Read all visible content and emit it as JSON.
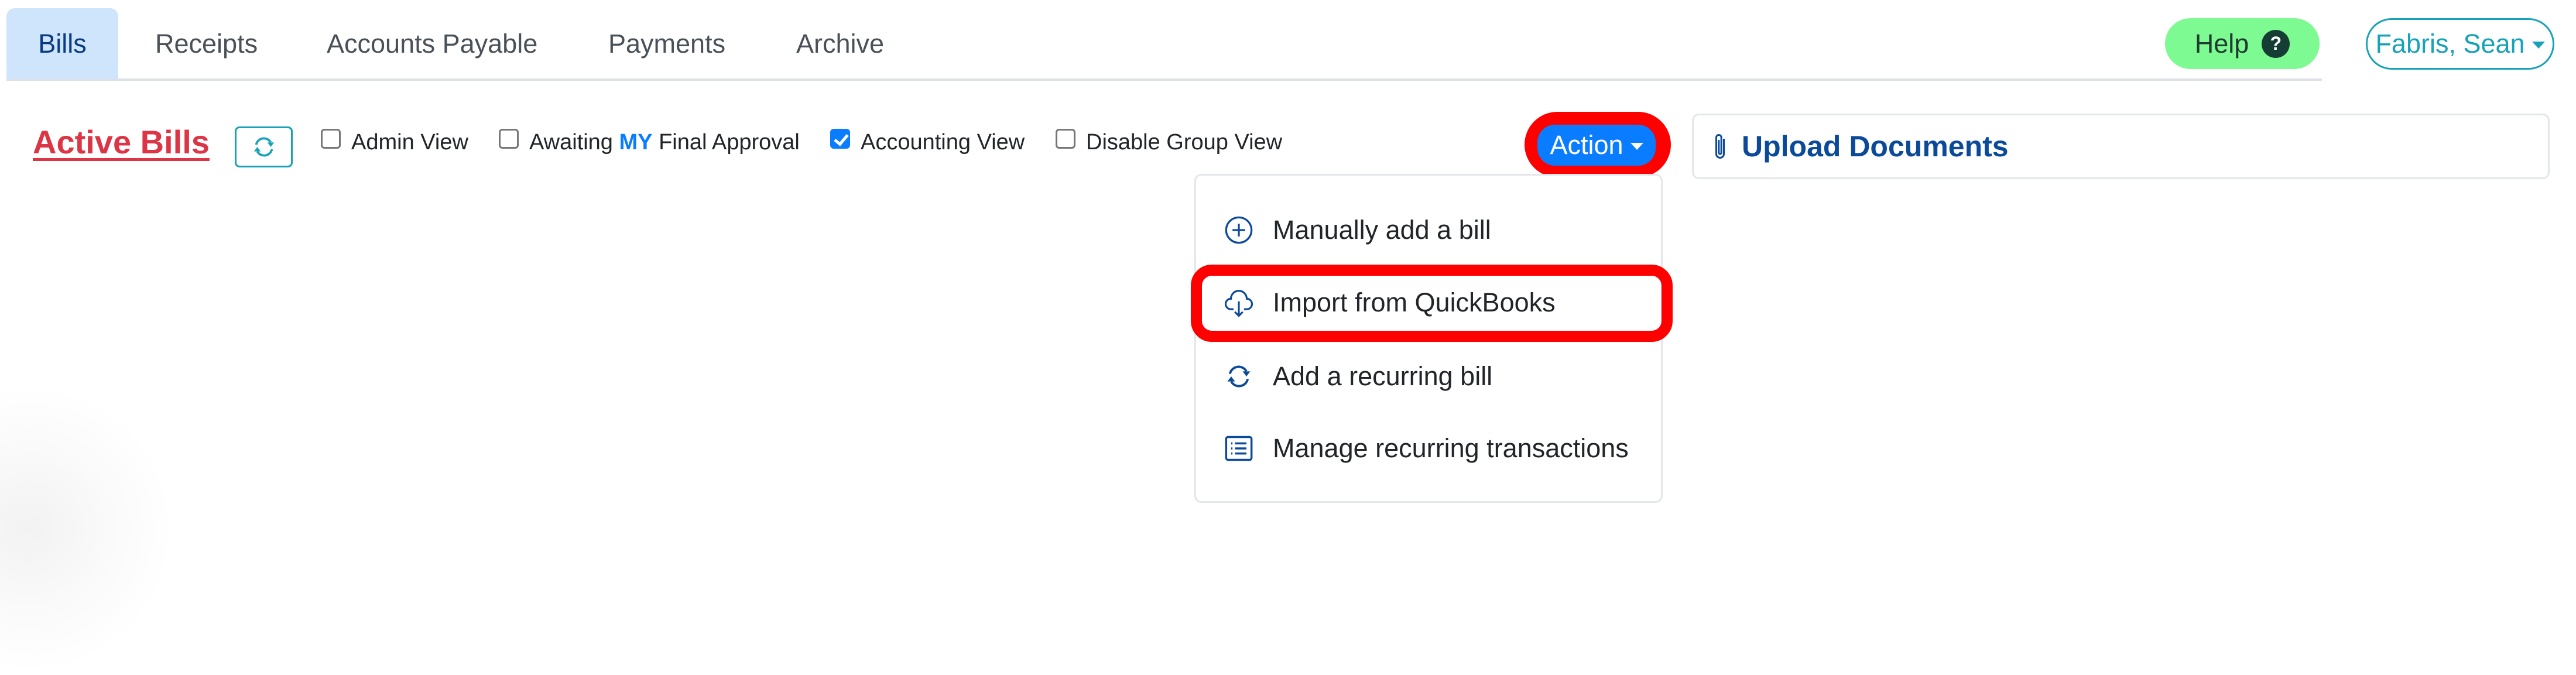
{
  "tabs": [
    {
      "label": "Bills",
      "active": true
    },
    {
      "label": "Receipts",
      "active": false
    },
    {
      "label": "Accounts Payable",
      "active": false
    },
    {
      "label": "Payments",
      "active": false
    },
    {
      "label": "Archive",
      "active": false
    }
  ],
  "header": {
    "help_label": "Help",
    "help_icon": "question-circle-icon",
    "user_label": "Fabris, Sean"
  },
  "toolbar": {
    "title": "Active Bills",
    "refresh_icon": "refresh-icon",
    "checkboxes": [
      {
        "label": "Admin View",
        "checked": false
      },
      {
        "label_prefix": "Awaiting ",
        "label_emphasis": "MY",
        "label_suffix": " Final Approval",
        "checked": false
      },
      {
        "label": "Accounting View",
        "checked": true
      },
      {
        "label": "Disable Group View",
        "checked": false
      }
    ],
    "action_label": "Action",
    "upload_label": "Upload Documents",
    "upload_icon": "paperclip-icon"
  },
  "action_menu": {
    "items": [
      {
        "label": "Manually add a bill",
        "icon": "plus-circle-icon"
      },
      {
        "label": "Import from QuickBooks",
        "icon": "cloud-download-icon",
        "highlighted": true
      },
      {
        "label": "Add a recurring bill",
        "icon": "recurring-arrows-icon"
      },
      {
        "label": "Manage recurring transactions",
        "icon": "list-icon"
      }
    ]
  },
  "colors": {
    "active_tab_bg": "#cfe5fc",
    "active_tab_text": "#0b3a85",
    "title_red": "#dc3545",
    "teal": "#17a2b8",
    "primary_blue": "#0a7cff",
    "help_green": "#7dfa92",
    "annotation_red": "#ff0000",
    "icon_blue": "#0b4a98"
  }
}
